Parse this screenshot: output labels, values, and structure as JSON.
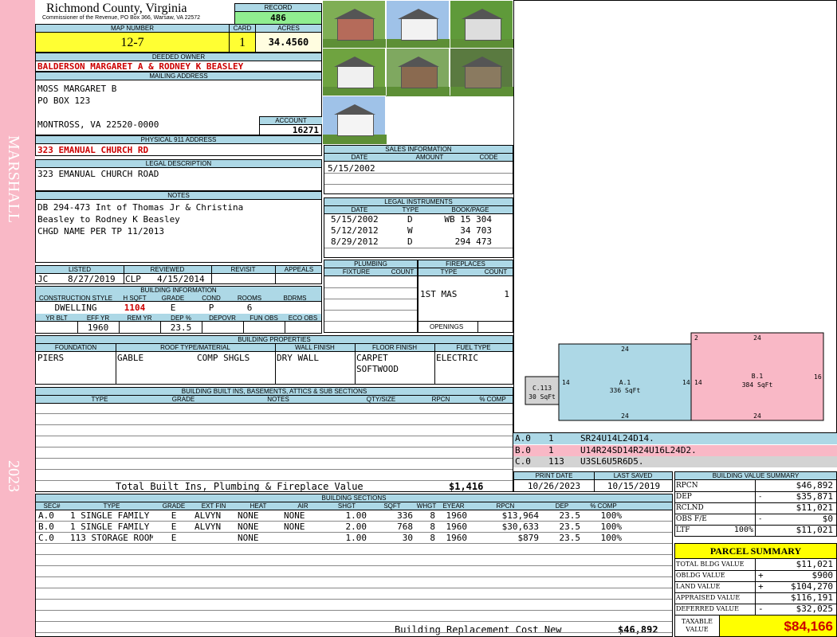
{
  "sidebar": {
    "district": "MARSHALL",
    "year": "2023"
  },
  "header": {
    "county": "Richmond County, Virginia",
    "address_line": "Commissioner of the Revenue, PO Box 366, Warsaw, VA 22572",
    "record_label": "RECORD",
    "record": "486",
    "map_number_label": "MAP NUMBER",
    "map_number": "12-7",
    "card_label": "CARD",
    "card": "1",
    "acres_label": "ACRES",
    "acres": "34.4560"
  },
  "owner": {
    "deeded_owner_label": "DEEDED OWNER",
    "deeded_owner": "BALDERSON MARGARET A & RODNEY K BEASLEY",
    "mailing_label": "MAILING ADDRESS",
    "mailing_line1": "MOSS MARGARET B",
    "mailing_line2": "PO BOX 123",
    "mailing_line3": "MONTROSS, VA 22520-0000",
    "account_label": "ACCOUNT",
    "account": "16271",
    "physical_label": "PHYSICAL 911 ADDRESS",
    "physical": "323 EMANUAL CHURCH RD",
    "legal_label": "LEGAL DESCRIPTION",
    "legal": "323 EMANUAL CHURCH ROAD",
    "notes_label": "NOTES",
    "notes_line1": "DB 294-473 Int of Thomas Jr & Christina",
    "notes_line2": "Beasley to Rodney K Beasley",
    "notes_line3": "CHGD NAME PER TP 11/2013"
  },
  "review": {
    "listed_label": "LISTED",
    "reviewed_label": "REVIEWED",
    "revisit_label": "REVISIT",
    "appeals_label": "APPEALS",
    "listed_by": "JC",
    "listed_date": "8/27/2019",
    "reviewed_by": "CLP",
    "reviewed_date": "4/15/2014"
  },
  "building_info": {
    "label": "BUILDING INFORMATION",
    "h": [
      "CONSTRUCTION STYLE",
      "H SQFT",
      "GRADE",
      "COND",
      "ROOMS",
      "BDRMS"
    ],
    "v": [
      "DWELLING",
      "1104",
      "E",
      "P",
      "6",
      ""
    ],
    "h2": [
      "YR BLT",
      "EFF YR",
      "REM YR",
      "DEP %",
      "DEPOVR",
      "FUN OBS",
      "ECO OBS"
    ],
    "v2": [
      "",
      "1960",
      "",
      "23.5",
      "",
      "",
      ""
    ]
  },
  "sales": {
    "label": "SALES INFORMATION",
    "h": [
      "DATE",
      "AMOUNT",
      "CODE"
    ],
    "rows": [
      [
        "5/15/2002",
        "",
        ""
      ]
    ]
  },
  "legal_instruments": {
    "label": "LEGAL INSTRUMENTS",
    "h": [
      "DATE",
      "TYPE",
      "BOOK/PAGE"
    ],
    "rows": [
      [
        "5/15/2002",
        "D",
        "WB 15 304"
      ],
      [
        "5/12/2012",
        "W",
        "34 703"
      ],
      [
        "8/29/2012",
        "D",
        "294 473"
      ]
    ]
  },
  "plumbing": {
    "label": "PLUMBING",
    "h": [
      "FIXTURE",
      "COUNT"
    ]
  },
  "fireplaces": {
    "label": "FIREPLACES",
    "h": [
      "TYPE",
      "COUNT"
    ],
    "type": "1ST MAS",
    "count": "1",
    "openings_label": "OPENINGS"
  },
  "properties": {
    "label": "BUILDING PROPERTIES",
    "h": [
      "FOUNDATION",
      "ROOF TYPE/MATERIAL",
      "WALL FINISH",
      "FLOOR FINISH",
      "FUEL TYPE"
    ],
    "foundation": "PIERS",
    "roof1": "GABLE",
    "roof2": "COMP SHGLS",
    "wall": "DRY WALL",
    "floor1": "CARPET",
    "floor2": "SOFTWOOD",
    "fuel": "ELECTRIC"
  },
  "builtins": {
    "label": "BUILDING BUILT INS, BASEMENTS, ATTICS & SUB SECTIONS",
    "h": [
      "TYPE",
      "GRADE",
      "NOTES",
      "QTY/SIZE",
      "RPCN",
      "% COMP"
    ],
    "total_label": "Total Built Ins, Plumbing & Fireplace Value",
    "total": "$1,416"
  },
  "sketch": {
    "a": {
      "name": "A.1",
      "area": "336 SqFt",
      "top": "24",
      "bottom": "24",
      "left": "14",
      "right": "14"
    },
    "b": {
      "name": "B.1",
      "area": "384 SqFt",
      "top": "24",
      "bottom": "24",
      "left": "14",
      "right": "16",
      "corner": "2"
    },
    "c": {
      "name": "C.113",
      "area": "30 SqFt"
    },
    "codes": [
      [
        "A.0",
        "1",
        "SR24U14L24D14."
      ],
      [
        "B.0",
        "1",
        "U14R24SD14R24U16L24D2."
      ],
      [
        "C.0",
        "113",
        "U3SL6U5R6D5."
      ]
    ],
    "colors": {
      "a": "#add8e6",
      "b": "#f9b8c6",
      "c": "#d3d3d3"
    }
  },
  "dates": {
    "print_label": "PRINT DATE",
    "print": "10/26/2023",
    "saved_label": "LAST SAVED",
    "saved": "10/15/2019"
  },
  "sections": {
    "label": "BUILDING SECTIONS",
    "h": [
      "SEC#",
      "TYPE",
      "GRADE",
      "EXT FIN",
      "HEAT",
      "AIR",
      "SHGT",
      "SQFT",
      "WHGT",
      "EYEAR",
      "RPCN",
      "DEP",
      "% COMP"
    ],
    "rows": [
      [
        "A.0",
        "1 SINGLE FAMILY",
        "E",
        "ALVYN",
        "NONE",
        "NONE",
        "1.00",
        "336",
        "8",
        "1960",
        "$13,964",
        "23.5",
        "100%"
      ],
      [
        "B.0",
        "1 SINGLE FAMILY",
        "E",
        "ALVYN",
        "NONE",
        "NONE",
        "2.00",
        "768",
        "8",
        "1960",
        "$30,633",
        "23.5",
        "100%"
      ],
      [
        "C.0",
        "113 STORAGE ROOM",
        "E",
        "",
        "NONE",
        "",
        "1.00",
        "30",
        "8",
        "1960",
        "$879",
        "23.5",
        "100%"
      ]
    ],
    "replacement_label": "Building Replacement Cost New",
    "replacement": "$46,892"
  },
  "value_summary": {
    "label": "BUILDING VALUE SUMMARY",
    "rows": [
      [
        "RPCN",
        "",
        "",
        "$46,892"
      ],
      [
        "DEP",
        "",
        "-",
        "$35,871"
      ],
      [
        "RCLND",
        "",
        "",
        "$11,021"
      ],
      [
        "OBS F/E",
        "",
        "-",
        "$0"
      ],
      [
        "LTF",
        "100%",
        "",
        "$11,021"
      ]
    ]
  },
  "parcel": {
    "label": "PARCEL SUMMARY",
    "rows": [
      [
        "TOTAL BLDG VALUE",
        "",
        "$11,021"
      ],
      [
        "OBLDG VALUE",
        "+",
        "$900"
      ],
      [
        "LAND VALUE",
        "+",
        "$104,270"
      ],
      [
        "APPRAISED VALUE",
        "",
        "$116,191"
      ],
      [
        "DEFERRED VALUE",
        "-",
        "$32,025"
      ]
    ],
    "taxable_label_1": "TAXABLE",
    "taxable_label_2": "VALUE",
    "taxable": "$84,166"
  },
  "photos": [
    {
      "name": "photo-house-1",
      "sky": "#7fae55",
      "body": "#b56b5a"
    },
    {
      "name": "photo-house-2",
      "sky": "#9fc2e8",
      "body": "#f2f2f2"
    },
    {
      "name": "photo-mailbox",
      "sky": "#5f9a3a",
      "body": "#dddddd"
    },
    {
      "name": "photo-house-3",
      "sky": "#6fa340",
      "body": "#f0f0f0"
    },
    {
      "name": "photo-house-4",
      "sky": "#7fa860",
      "body": "#8a6a50"
    },
    {
      "name": "photo-shed",
      "sky": "#5a7a40",
      "body": "#8a7a60"
    },
    {
      "name": "photo-house-5",
      "sky": "#9fc2e8",
      "body": "#f4f4f4"
    }
  ]
}
